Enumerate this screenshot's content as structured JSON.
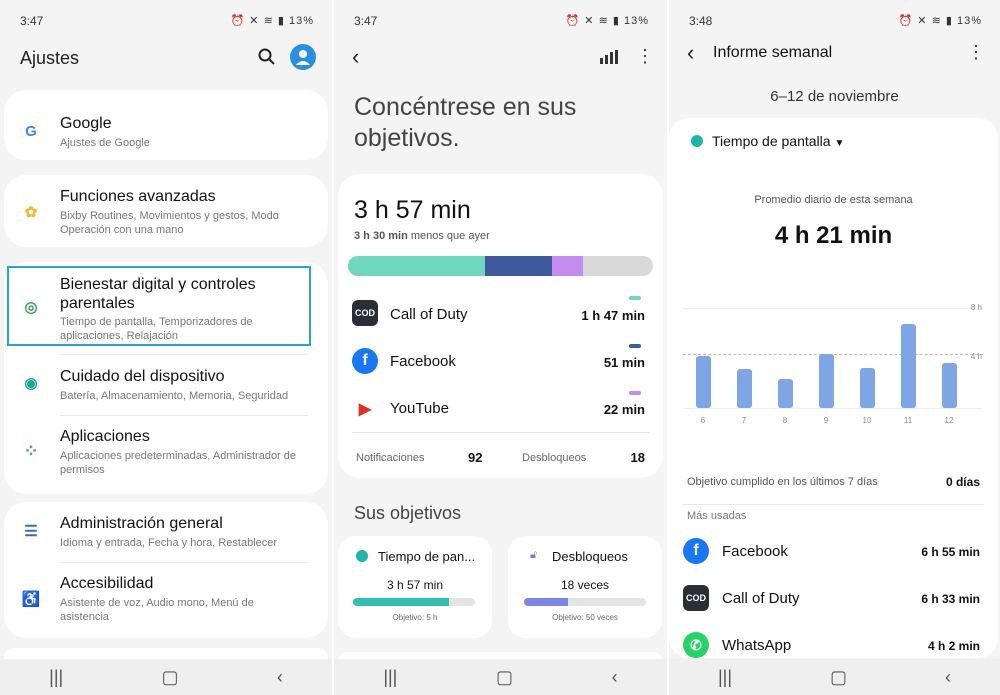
{
  "status": {
    "p1_time": "3:47",
    "p2_time": "3:47",
    "p3_time": "3:48",
    "battery": "13%"
  },
  "settings": {
    "title": "Ajustes",
    "items": [
      {
        "title": "Google",
        "sub": "Ajustes de Google"
      },
      {
        "title": "Funciones avanzadas",
        "sub": "Bixby Routines, Movimientos y gestos, Modo Operación con una mano"
      },
      {
        "title": "Bienestar digital y controles parentales",
        "sub": "Tiempo de pantalla, Temporizadores de aplicaciones, Relajación"
      },
      {
        "title": "Cuidado del dispositivo",
        "sub": "Batería, Almacenamiento, Memoria, Seguridad"
      },
      {
        "title": "Aplicaciones",
        "sub": "Aplicaciones predeterminadas, Administrador de permisos"
      },
      {
        "title": "Administración general",
        "sub": "Idioma y entrada, Fecha y hora, Restablecer"
      },
      {
        "title": "Accesibilidad",
        "sub": "Asistente de voz, Audio mono, Menú de asistencia"
      }
    ]
  },
  "wellbeing": {
    "headline": "Concéntrese en sus objetivos.",
    "total": "3 h 57 min",
    "compare_bold": "3 h 30 min",
    "compare_rest": " menos que ayer",
    "usage_split": [
      0.45,
      0.22,
      0.1,
      0.23
    ],
    "apps": [
      {
        "name": "Call of Duty",
        "time": "1 h 47 min",
        "color": "#6fd6c0"
      },
      {
        "name": "Facebook",
        "time": "51 min",
        "color": "#3f5a9a"
      },
      {
        "name": "YouTube",
        "time": "22 min",
        "color": "#c58cf0"
      }
    ],
    "notif_label": "Notificaciones",
    "notif_value": "92",
    "unlock_label": "Desbloqueos",
    "unlock_value": "18",
    "goals_title": "Sus objetivos",
    "goal1": {
      "title": "Tiempo de pan...",
      "value": "3 h 57 min",
      "target": "Objetivo: 5 h",
      "progress": 0.79
    },
    "goal2": {
      "title": "Desbloqueos",
      "value": "18 veces",
      "target": "Objetivo: 50 veces",
      "progress": 0.36
    }
  },
  "report": {
    "title": "Informe semanal",
    "range": "6–12 de noviembre",
    "dropdown": "Tiempo de pantalla",
    "avg_label": "Promedio diario de esta semana",
    "avg_value": "4 h 21 min",
    "chart_data": {
      "type": "bar",
      "categories": [
        "6",
        "7",
        "8",
        "9",
        "10",
        "11",
        "12"
      ],
      "values": [
        4.2,
        3.1,
        2.3,
        4.3,
        3.2,
        6.7,
        3.6
      ],
      "ylim": [
        0,
        8
      ],
      "yticks": [
        "8 h",
        "4 h"
      ],
      "avg": 4.35
    },
    "goal_label": "Objetivo cumplido en los últimos 7 días",
    "goal_value": "0 días",
    "most_used": "Más usadas",
    "apps": [
      {
        "name": "Facebook",
        "time": "6 h 55 min"
      },
      {
        "name": "Call of Duty",
        "time": "6 h 33 min"
      },
      {
        "name": "WhatsApp",
        "time": "4 h 2 min"
      }
    ]
  }
}
